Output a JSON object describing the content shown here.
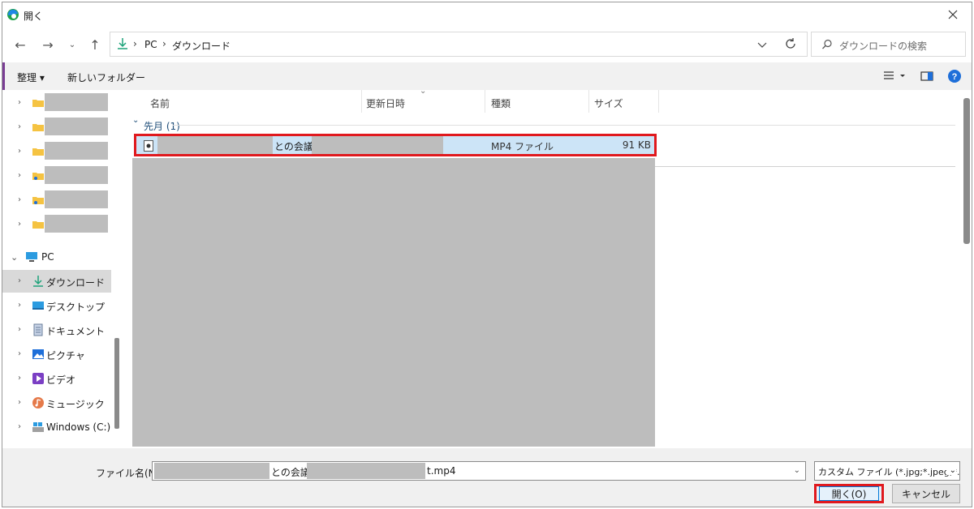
{
  "window": {
    "title": "開く"
  },
  "nav": {
    "address": [
      "PC",
      "ダウンロード"
    ],
    "search_placeholder": "ダウンロードの検索"
  },
  "commandbar": {
    "organize": "整理 ▾",
    "new_folder": "新しいフォルダー"
  },
  "navpane": {
    "pc_label": "PC",
    "items": [
      {
        "label": "ダウンロード",
        "icon": "download-icon"
      },
      {
        "label": "デスクトップ",
        "icon": "desktop-icon"
      },
      {
        "label": "ドキュメント",
        "icon": "document-icon"
      },
      {
        "label": "ピクチャ",
        "icon": "pictures-icon"
      },
      {
        "label": "ビデオ",
        "icon": "video-icon"
      },
      {
        "label": "ミュージック",
        "icon": "music-icon"
      },
      {
        "label": "Windows (C:)",
        "icon": "drive-icon"
      }
    ]
  },
  "columns": {
    "name": "名前",
    "date": "更新日時",
    "type": "種類",
    "size": "サイズ"
  },
  "group": {
    "label": "先月 (1)"
  },
  "file": {
    "name_visible": "との会議-",
    "type": "MP4 ファイル",
    "size": "91 KB"
  },
  "bottom": {
    "filename_label": "ファイル名(N):",
    "filename_visible": "との会議-",
    "filename_ext": "t.mp4",
    "filter": "カスタム ファイル (*.jpg;*.jpeg;*.gif;",
    "open_label": "開く(O)",
    "cancel_label": "キャンセル"
  },
  "colors": {
    "accent": "#7a3e94",
    "highlight_red": "#e0191e",
    "selection": "#cce4f7",
    "help_blue": "#0078d7"
  }
}
